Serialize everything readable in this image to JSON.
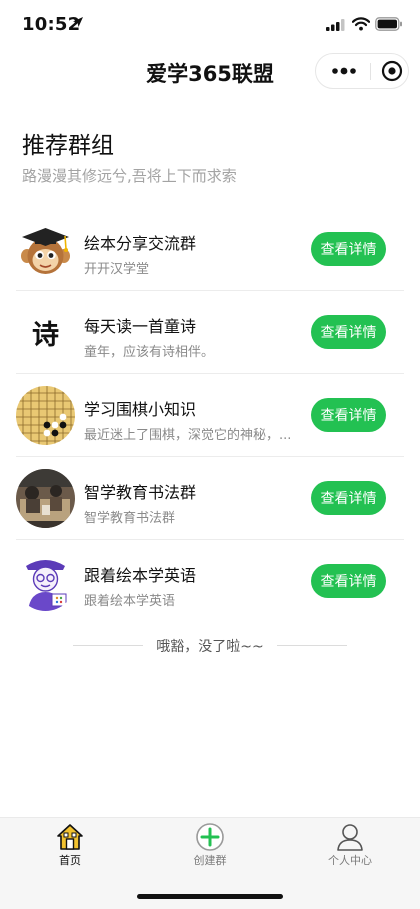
{
  "status_bar": {
    "time": "10:52"
  },
  "nav": {
    "title": "爱学365联盟"
  },
  "header": {
    "title": "推荐群组",
    "subtitle": "路漫漫其修远兮,吾将上下而求索"
  },
  "groups": [
    {
      "name": "绘本分享交流群",
      "desc": "开开汉学堂",
      "button": "查看详情",
      "avatar": "monkey-graduation-cap"
    },
    {
      "name": "每天读一首童诗",
      "desc": "童年，应该有诗相伴。",
      "button": "查看详情",
      "avatar": "poem-character"
    },
    {
      "name": "学习围棋小知识",
      "desc": "最近迷上了围棋，深觉它的神秘，...",
      "button": "查看详情",
      "avatar": "go-board"
    },
    {
      "name": "智学教育书法群",
      "desc": "智学教育书法群",
      "button": "查看详情",
      "avatar": "calligraphy-photo"
    },
    {
      "name": "跟着绘本学英语",
      "desc": "跟着绘本学英语",
      "button": "查看详情",
      "avatar": "teacher-cartoon"
    }
  ],
  "poem_char": "诗",
  "end_text": "哦豁，没了啦~~",
  "tabs": [
    {
      "label": "首页",
      "icon": "home-icon",
      "active": true
    },
    {
      "label": "创建群",
      "icon": "add-circle-icon",
      "active": false
    },
    {
      "label": "个人中心",
      "icon": "user-icon",
      "active": false
    }
  ],
  "colors": {
    "accent": "#23c152",
    "tab_bar": "#f6f6f6",
    "subtitle": "#a3a3a3"
  }
}
